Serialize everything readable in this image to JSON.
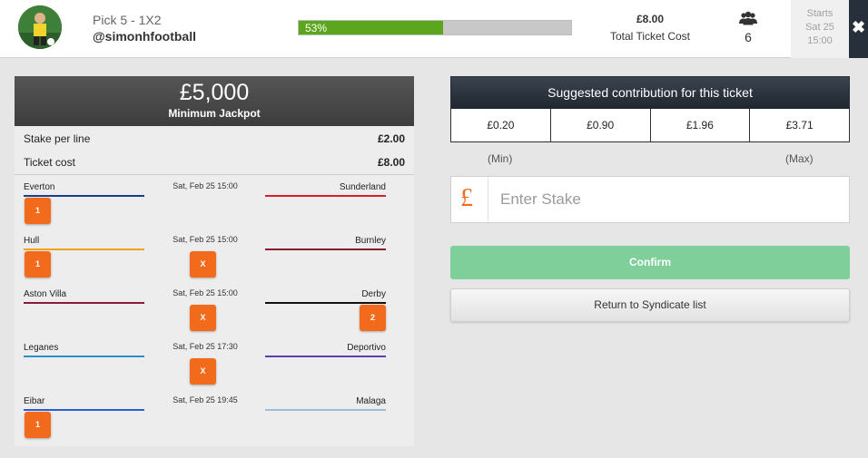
{
  "header": {
    "pick_title": "Pick 5 - 1X2",
    "username": "@simonhfootball",
    "progress_percent": 53,
    "progress_label": "53%",
    "ticket_cost": "£8.00",
    "ticket_cost_label": "Total Ticket Cost",
    "members_icon": "people-icon",
    "members_count": "6",
    "starts_label": "Starts",
    "starts_date": "Sat 25",
    "starts_time": "15:00",
    "close_icon": "close-icon",
    "close_symbol": "✖"
  },
  "ticket": {
    "jackpot_amount": "£5,000",
    "jackpot_label": "Minimum Jackpot",
    "stake_per_line_label": "Stake per line",
    "stake_per_line_value": "£2.00",
    "ticket_cost_label": "Ticket cost",
    "ticket_cost_value": "£8.00",
    "matches": [
      {
        "home": "Everton",
        "away": "Sunderland",
        "date": "Sat, Feb 25 15:00",
        "home_color": "#1b3e8c",
        "away_color": "#d3202d",
        "selections": [
          "1"
        ]
      },
      {
        "home": "Hull",
        "away": "Burnley",
        "date": "Sat, Feb 25 15:00",
        "home_color": "#f0a21a",
        "away_color": "#8a1c2c",
        "selections": [
          "1",
          "X"
        ]
      },
      {
        "home": "Aston Villa",
        "away": "Derby",
        "date": "Sat, Feb 25 15:00",
        "home_color": "#8b1a3a",
        "away_color": "#111111",
        "selections": [
          "X",
          "2"
        ]
      },
      {
        "home": "Leganes",
        "away": "Deportivo",
        "date": "Sat, Feb 25 17:30",
        "home_color": "#2a8fc8",
        "away_color": "#5b3fb0",
        "selections": [
          "X"
        ]
      },
      {
        "home": "Eibar",
        "away": "Malaga",
        "date": "Sat, Feb 25 19:45",
        "home_color": "#2a5fd8",
        "away_color": "#9bbbd8",
        "selections": [
          "1"
        ]
      }
    ]
  },
  "suggest": {
    "title": "Suggested contribution for this ticket",
    "amounts": [
      "£0.20",
      "£0.90",
      "£1.96",
      "£3.71"
    ],
    "min_label": "(Min)",
    "max_label": "(Max)"
  },
  "stake": {
    "currency_symbol": "£",
    "placeholder": "Enter Stake",
    "value": ""
  },
  "actions": {
    "confirm_label": "Confirm",
    "return_label": "Return to Syndicate list"
  },
  "colors": {
    "accent_orange": "#f26a1b",
    "progress_green": "#5ca61e",
    "confirm_green": "#7fcf9a",
    "dark_header": "#27303a"
  }
}
